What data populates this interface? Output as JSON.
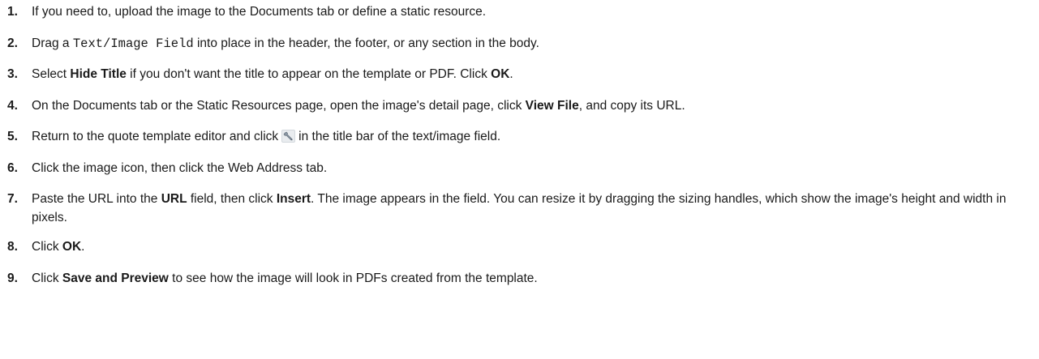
{
  "steps": [
    {
      "num": "1.",
      "text": "If you need to, upload the image to the Documents tab or define a static resource."
    },
    {
      "num": "2.",
      "pre": "Drag a ",
      "code": "Text/Image Field",
      "post": " into place in the header, the footer, or any section in the body."
    },
    {
      "num": "3.",
      "pre": "Select ",
      "kw1": "Hide Title",
      "mid": " if you don't want the title to appear on the template or PDF. Click ",
      "kw2": "OK",
      "post": "."
    },
    {
      "num": "4.",
      "pre": "On the Documents tab or the Static Resources page, open the image's detail page, click ",
      "kw1": "View File",
      "post": ", and copy its URL."
    },
    {
      "num": "5.",
      "pre": "Return to the quote template editor and click",
      "icon": "wrench-icon",
      "post": "in the title bar of the text/image field."
    },
    {
      "num": "6.",
      "text": "Click the image icon, then click the Web Address tab."
    },
    {
      "num": "7.",
      "pre": "Paste the URL into the ",
      "kw1": "URL",
      "mid": " field, then click ",
      "kw2": "Insert",
      "post": ". The image appears in the field. You can resize it by dragging the sizing handles, which show the image's height and width in pixels."
    },
    {
      "num": "8.",
      "pre": "Click ",
      "kw1": "OK",
      "post": "."
    },
    {
      "num": "9.",
      "pre": "Click ",
      "kw1": "Save and Preview",
      "post": " to see how the image will look in PDFs created from the template."
    }
  ]
}
